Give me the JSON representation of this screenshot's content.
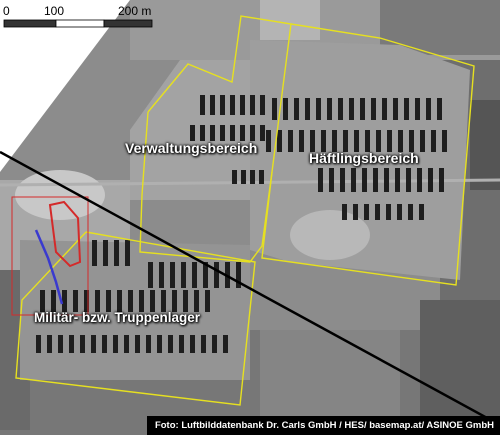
{
  "scale_bar": {
    "ticks": [
      "0",
      "100",
      "200 m"
    ],
    "colors": {
      "dark": "#333333",
      "light": "#ffffff"
    }
  },
  "labels": {
    "administration_area": "Verwaltungsbereich",
    "prisoner_area": "Häftlingsbereich",
    "military_camp": "Militär- bzw. Truppenlager"
  },
  "credit": "Foto: Luftbilddatenbank Dr. Carls GmbH / HES/ basemap.at/ ASINOE GmbH",
  "colors": {
    "boundary": "#e6e020",
    "marker_red": "#d42a2a",
    "marker_blue": "#3a3acf",
    "photo_bg": "#8f8f8f",
    "barracks": "#1e1e1e",
    "cut_line": "#000000"
  }
}
